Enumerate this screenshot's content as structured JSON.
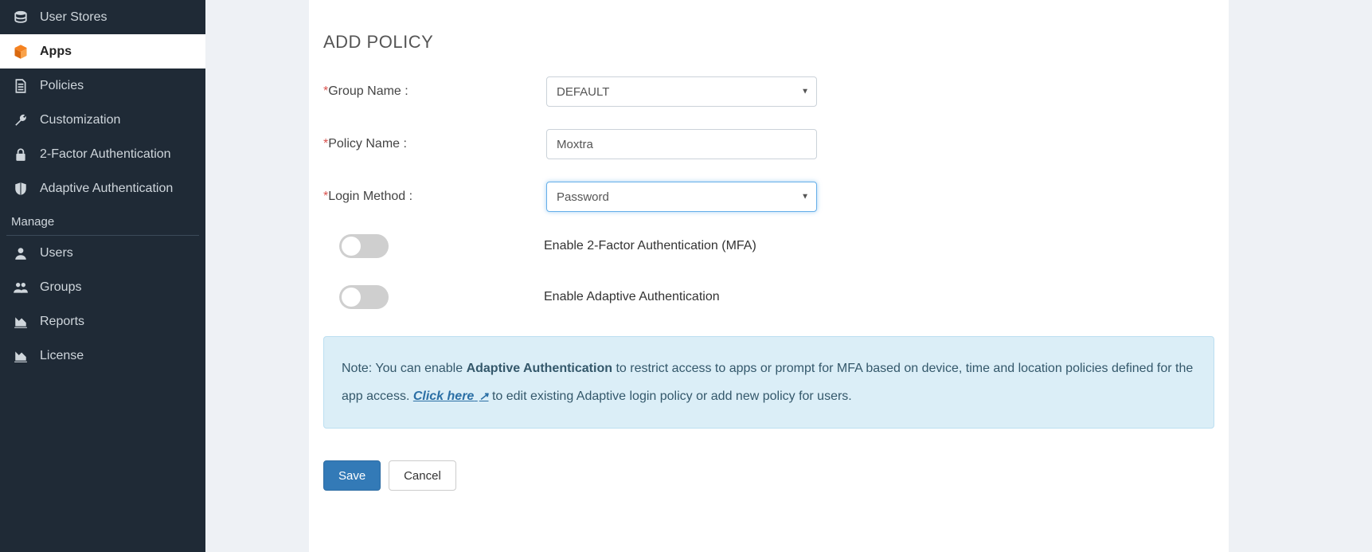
{
  "sidebar": {
    "items": [
      {
        "label": "User Stores",
        "icon": "database-icon"
      },
      {
        "label": "Apps",
        "icon": "cube-icon",
        "active": true
      },
      {
        "label": "Policies",
        "icon": "document-icon"
      },
      {
        "label": "Customization",
        "icon": "wrench-icon"
      },
      {
        "label": "2-Factor Authentication",
        "icon": "lock-icon"
      },
      {
        "label": "Adaptive Authentication",
        "icon": "shield-icon"
      }
    ],
    "manage_label": "Manage",
    "manage_items": [
      {
        "label": "Users",
        "icon": "user-icon"
      },
      {
        "label": "Groups",
        "icon": "group-icon"
      },
      {
        "label": "Reports",
        "icon": "chart-icon"
      },
      {
        "label": "License",
        "icon": "chart-icon"
      }
    ]
  },
  "page": {
    "title": "ADD POLICY"
  },
  "form": {
    "group_name_label": "Group Name :",
    "group_name_value": "DEFAULT",
    "policy_name_label": "Policy Name :",
    "policy_name_value": "Moxtra",
    "login_method_label": "Login Method :",
    "login_method_value": "Password",
    "enable_mfa_label": "Enable 2-Factor Authentication (MFA)",
    "enable_mfa_on": false,
    "enable_adaptive_label": "Enable Adaptive Authentication",
    "enable_adaptive_on": false
  },
  "note": {
    "prefix": "Note: You can enable ",
    "bold": "Adaptive Authentication",
    "mid": " to restrict access to apps or prompt for MFA based on device, time and location policies defined for the app access. ",
    "link": "Click here",
    "suffix": " to edit existing Adaptive login policy or add new policy for users."
  },
  "buttons": {
    "save": "Save",
    "cancel": "Cancel"
  }
}
